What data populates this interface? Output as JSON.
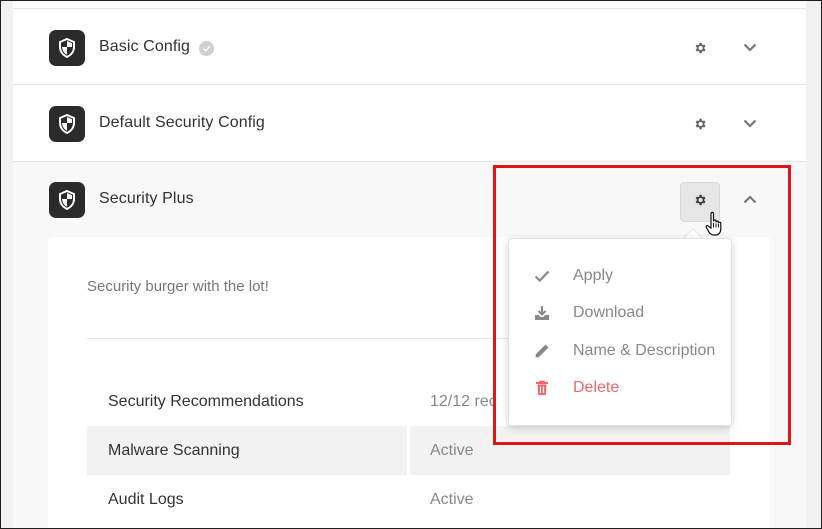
{
  "configs": [
    {
      "title": "Basic Config",
      "verified": true,
      "expanded": false
    },
    {
      "title": "Default Security Config",
      "verified": false,
      "expanded": false
    },
    {
      "title": "Security Plus",
      "verified": false,
      "expanded": true
    }
  ],
  "expanded": {
    "description": "Security burger with the lot!",
    "stats": [
      {
        "label": "Security Recommendations",
        "value": "12/12 rec"
      },
      {
        "label": "Malware Scanning",
        "value": "Active"
      },
      {
        "label": "Audit Logs",
        "value": "Active"
      }
    ]
  },
  "menu": {
    "items": [
      {
        "label": "Apply",
        "icon": "check-icon"
      },
      {
        "label": "Download",
        "icon": "download-icon"
      },
      {
        "label": "Name & Description",
        "icon": "pencil-icon"
      },
      {
        "label": "Delete",
        "icon": "trash-icon"
      }
    ]
  },
  "colors": {
    "highlight": "#e0151b",
    "delete": "#f26767",
    "tile": "#2b2b2b"
  }
}
